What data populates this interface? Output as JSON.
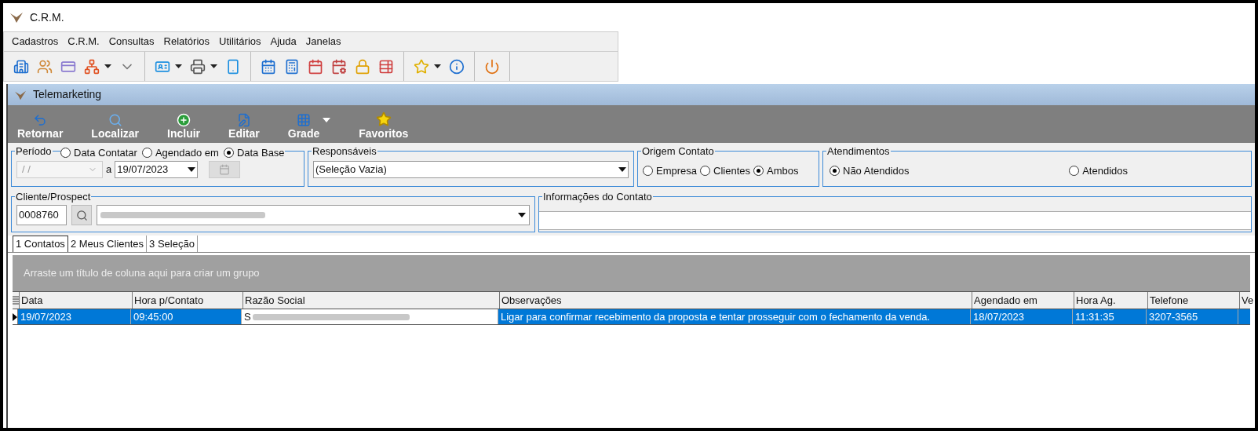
{
  "window": {
    "title": "C.R.M."
  },
  "menu": [
    {
      "label": "Cadastros"
    },
    {
      "label": "C.R.M."
    },
    {
      "label": "Consultas"
    },
    {
      "label": "Relatórios"
    },
    {
      "label": "Utilitários"
    },
    {
      "label": "Ajuda"
    },
    {
      "label": "Janelas"
    }
  ],
  "child_window": {
    "title": "Telemarketing"
  },
  "actions": [
    {
      "label": "Retornar",
      "kind": "back"
    },
    {
      "label": "Localizar",
      "kind": "search"
    },
    {
      "label": "Incluir",
      "kind": "add"
    },
    {
      "label": "Editar",
      "kind": "edit"
    },
    {
      "label": "Grade",
      "kind": "grid",
      "has_menu": true
    },
    {
      "label": "Favoritos",
      "kind": "star"
    }
  ],
  "periodo": {
    "label": "Período",
    "options": [
      {
        "label": "Data Contatar",
        "selected": false
      },
      {
        "label": "Agendado em",
        "selected": false
      },
      {
        "label": "Data Base",
        "selected": true
      }
    ],
    "from": "/ /",
    "to_label": "a",
    "to": "19/07/2023"
  },
  "responsaveis": {
    "label": "Responsáveis",
    "value": "(Seleção Vazia)"
  },
  "origem": {
    "label": "Origem Contato",
    "options": [
      {
        "label": "Empresa",
        "selected": false
      },
      {
        "label": "Clientes",
        "selected": false
      },
      {
        "label": "Ambos",
        "selected": true
      }
    ]
  },
  "atendimentos": {
    "label": "Atendimentos",
    "options": [
      {
        "label": "Não Atendidos",
        "selected": true
      },
      {
        "label": "Atendidos",
        "selected": false
      }
    ]
  },
  "cliente": {
    "label": "Cliente/Prospect",
    "code": "0008760"
  },
  "informacoes": {
    "label": "Informações do Contato"
  },
  "tabs": [
    {
      "label": "1 Contatos",
      "selected": true
    },
    {
      "label": "2 Meus Clientes",
      "selected": false
    },
    {
      "label": "3 Seleção",
      "selected": false
    }
  ],
  "group_hint": "Arraste um título de coluna aqui para criar um grupo",
  "table": {
    "columns": [
      "Data",
      "Hora p/Contato",
      "Razão Social",
      "Observações",
      "Agendado em",
      "Hora Ag.",
      "Telefone",
      "Ve"
    ],
    "rows": [
      {
        "selected": true,
        "cells": [
          "19/07/2023",
          "09:45:00",
          "S",
          "Ligar para confirmar recebimento da proposta e tentar prosseguir com o fechamento da venda.",
          "18/07/2023",
          "11:31:35",
          "3207-3565"
        ]
      }
    ]
  }
}
